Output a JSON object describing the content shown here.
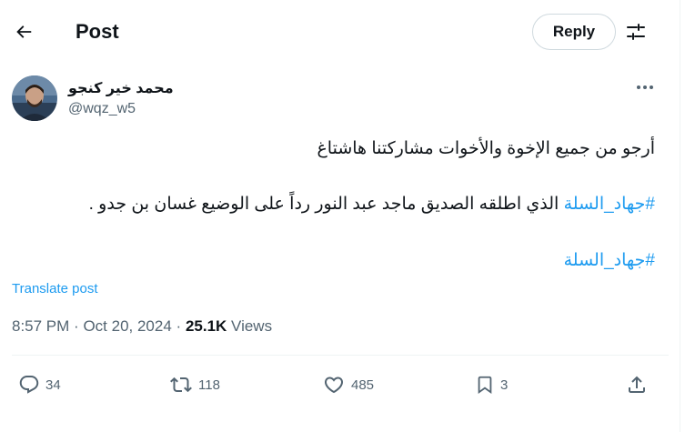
{
  "header": {
    "title": "Post",
    "reply_label": "Reply"
  },
  "author": {
    "name": "محمد خير كنجو",
    "handle": "@wqz_w5"
  },
  "tweet": {
    "line1": "أرجو من جميع الإخوة والأخوات مشاركتنا هاشتاغ",
    "hashtag1": "#جهاد_السلة",
    "line2_rest": " الذي اطلقه الصديق ماجد عبد النور رداً على الوضيع غسان بن جدو .",
    "hashtag2": "#جهاد_السلة"
  },
  "translate_label": "Translate post",
  "meta": {
    "time": "8:57 PM",
    "separator": "·",
    "date": "Oct 20, 2024",
    "views_count": "25.1K",
    "views_label": "Views"
  },
  "actions": {
    "replies": "34",
    "reposts": "118",
    "likes": "485",
    "bookmarks": "3"
  },
  "icons": [
    "back-arrow-icon",
    "tune-icon",
    "more-icon",
    "reply-icon",
    "repost-icon",
    "like-icon",
    "bookmark-icon",
    "share-icon"
  ],
  "colors": {
    "accent": "#1d9bf0",
    "text": "#0f1419",
    "secondary": "#536471",
    "border": "#cfd9de"
  }
}
